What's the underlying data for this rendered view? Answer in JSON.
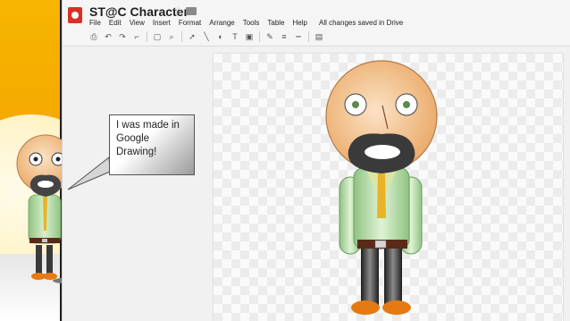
{
  "app": {
    "title": "ST@C Character",
    "menu": [
      "File",
      "Edit",
      "View",
      "Insert",
      "Format",
      "Arrange",
      "Tools",
      "Table",
      "Help"
    ],
    "save_status": "All changes saved in Drive",
    "toolbar_icons": [
      "print-icon",
      "undo-icon",
      "redo-icon",
      "paint-format-icon",
      "fit-icon",
      "zoom-icon",
      "select-icon",
      "line-icon",
      "shape-icon",
      "text-box-icon",
      "image-icon",
      "pen-color-icon",
      "line-weight-icon",
      "line-dash-icon",
      "comment-icon"
    ]
  },
  "speech_bubble": {
    "text": "I was made in Google Drawing!"
  },
  "colors": {
    "stage": "#f4a800",
    "skin": "#f3c08f",
    "shirt": "#a9d29c",
    "vest": "#d9e6a8",
    "tie": "#e8b32a",
    "belt": "#5a2a18",
    "pants": "#3a3a3a",
    "shoes": "#e57a12"
  }
}
